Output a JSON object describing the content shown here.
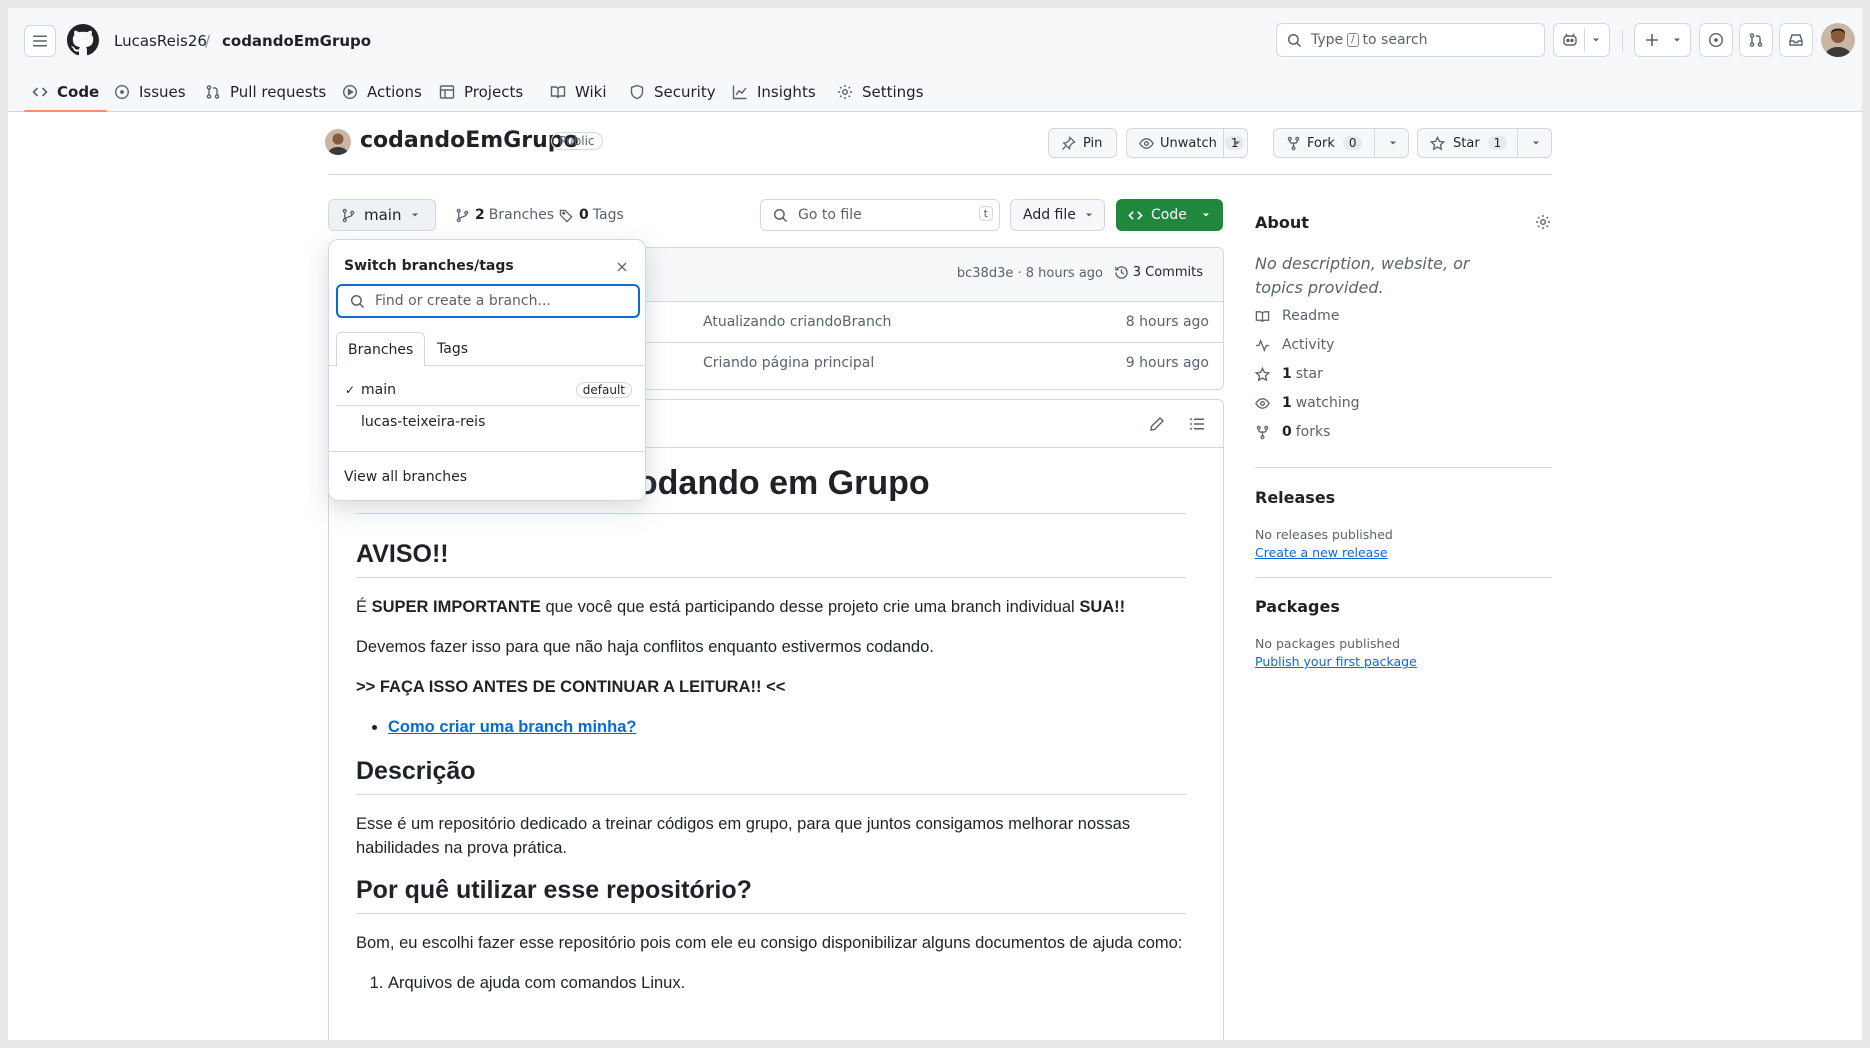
{
  "header": {
    "owner": "LucasReis26",
    "separator": "/",
    "repo": "codandoEmGrupo",
    "search_prefix": "Type",
    "search_key": "/",
    "search_suffix": "to search"
  },
  "tabs": [
    {
      "label": "Code",
      "icon": "code-icon",
      "active": true
    },
    {
      "label": "Issues",
      "icon": "issue-icon"
    },
    {
      "label": "Pull requests",
      "icon": "pull-request-icon"
    },
    {
      "label": "Actions",
      "icon": "play-icon"
    },
    {
      "label": "Projects",
      "icon": "table-icon"
    },
    {
      "label": "Wiki",
      "icon": "book-icon"
    },
    {
      "label": "Security",
      "icon": "shield-icon"
    },
    {
      "label": "Insights",
      "icon": "graph-icon"
    },
    {
      "label": "Settings",
      "icon": "gear-icon"
    }
  ],
  "repo": {
    "name": "codandoEmGrupo",
    "visibility": "Public",
    "pin_label": "Pin",
    "watch_label": "Unwatch",
    "watch_count": "1",
    "fork_label": "Fork",
    "fork_count": "0",
    "star_label": "Star",
    "star_count": "1"
  },
  "toolbar": {
    "branch": "main",
    "branches_count": "2",
    "branches_label": "Branches",
    "tags_count": "0",
    "tags_label": "Tags",
    "goto_placeholder": "Go to file",
    "goto_key": "t",
    "add_file": "Add file",
    "code": "Code"
  },
  "commit": {
    "hash_time": "bc38d3e · 8 hours ago",
    "commits_label": "3 Commits"
  },
  "files": [
    {
      "message": "Atualizando criandoBranch",
      "time": "8 hours ago"
    },
    {
      "message": "Criando página principal",
      "time": "9 hours ago"
    }
  ],
  "readme": {
    "h1": "Codando em Grupo",
    "h2_aviso": "AVISO!!",
    "p1_a": "É ",
    "p1_b": "SUPER IMPORTANTE",
    "p1_c": " que você que está participando desse projeto crie uma branch individual ",
    "p1_d": "SUA!!",
    "p2": "Devemos fazer isso para que não haja conflitos enquanto estivermos codando.",
    "p3": ">> FAÇA ISSO ANTES DE CONTINUAR A LEITURA!! <<",
    "link": "Como criar uma branch minha?",
    "h2_desc": "Descrição",
    "p4": "Esse é um repositório dedicado a treinar códigos em grupo, para que juntos consigamos melhorar nossas habilidades na prova prática.",
    "h2_why": "Por quê utilizar esse repositório?",
    "p5": "Bom, eu escolhi fazer esse repositório pois com ele eu consigo disponibilizar alguns documentos de ajuda como:",
    "li1": "Arquivos de ajuda com comandos Linux."
  },
  "about": {
    "title": "About",
    "desc": "No description, website, or topics provided.",
    "readme": "Readme",
    "activity": "Activity",
    "stars_n": "1",
    "stars": "star",
    "watching_n": "1",
    "watching": "watching",
    "forks_n": "0",
    "forks": "forks"
  },
  "releases": {
    "title": "Releases",
    "none": "No releases published",
    "link": "Create a new release"
  },
  "packages": {
    "title": "Packages",
    "none": "No packages published",
    "link": "Publish your first package"
  },
  "dropdown": {
    "title": "Switch branches/tags",
    "placeholder": "Find or create a branch...",
    "tab_branches": "Branches",
    "tab_tags": "Tags",
    "items": [
      {
        "name": "main",
        "checked": true,
        "badge": "default"
      },
      {
        "name": "lucas-teixeira-reis"
      }
    ],
    "footer": "View all branches"
  },
  "colors": {
    "accent": "#0969da",
    "primary_button": "#1f883d",
    "tab_underline": "#fd8c73"
  }
}
